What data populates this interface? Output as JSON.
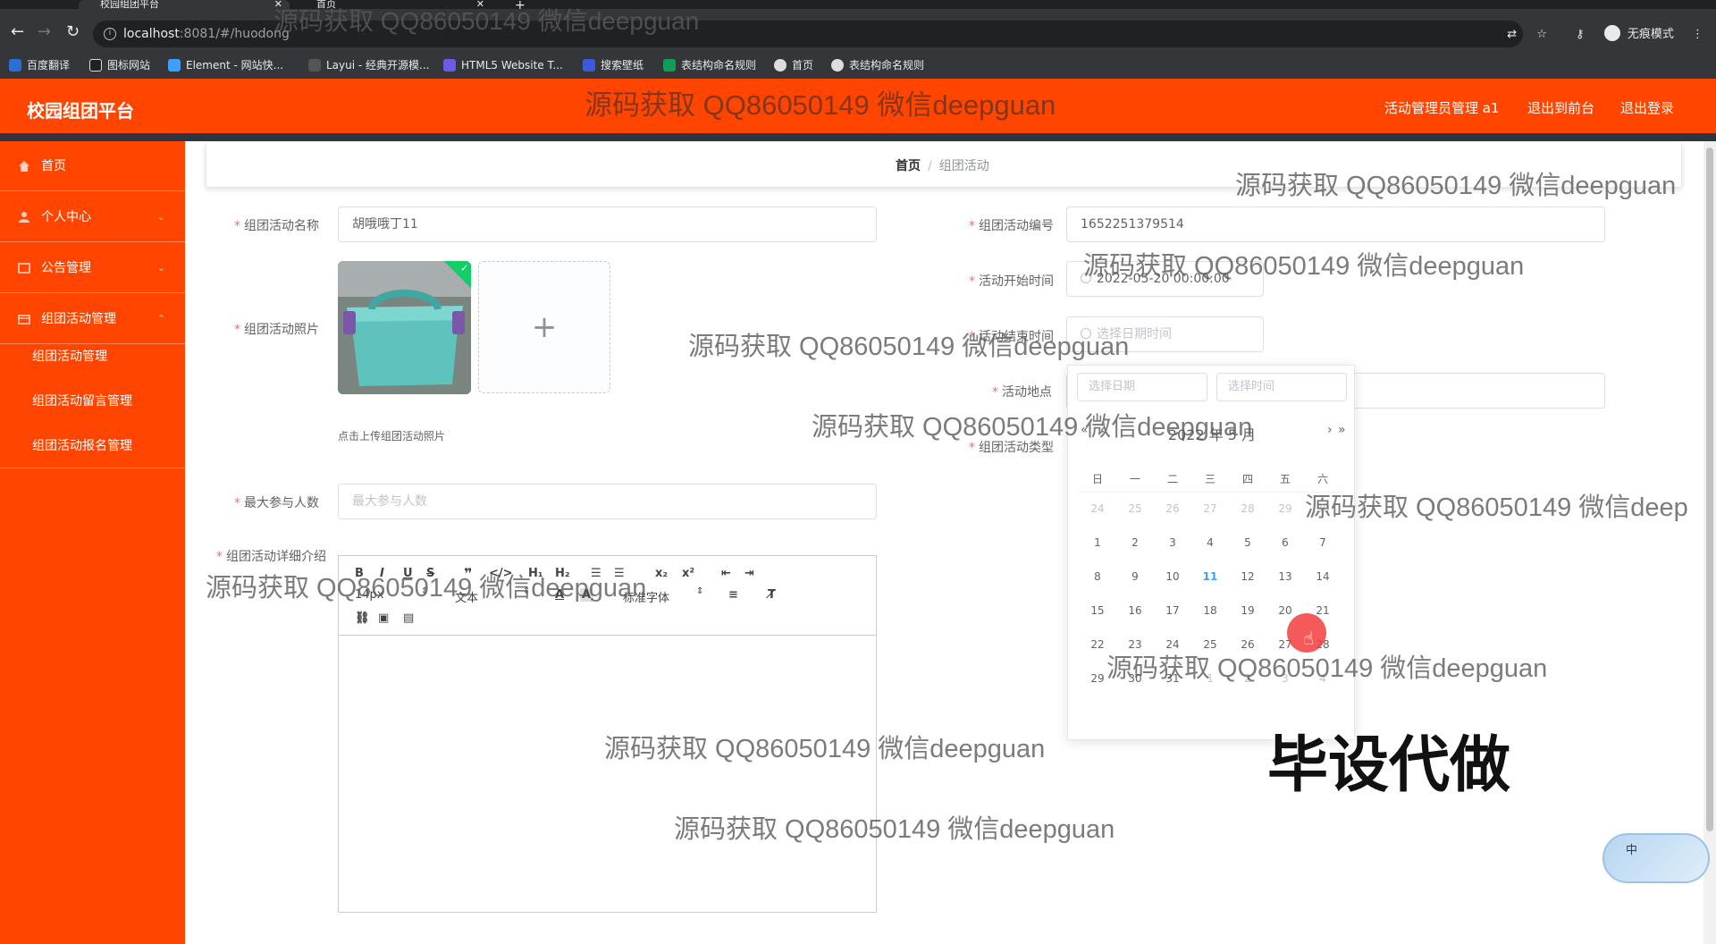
{
  "browser": {
    "tabs": [
      {
        "title": "校园组团平台"
      },
      {
        "title": "首页"
      }
    ],
    "url_host": "localhost",
    "url_path": ":8081/#/huodong",
    "profile_label": "无痕模式",
    "bookmarks": [
      {
        "label": "百度翻译",
        "color": "#2b6fd6"
      },
      {
        "label": "图标网站",
        "color": "#222222"
      },
      {
        "label": "Element - 网站快...",
        "color": "#409eff"
      },
      {
        "label": "Layui - 经典开源模...",
        "color": "#555555"
      },
      {
        "label": "HTML5 Website T...",
        "color": "#6b5ce7"
      },
      {
        "label": "搜索壁纸",
        "color": "#3b5bdb"
      },
      {
        "label": "表结构命名规则",
        "color": "#0f9d58"
      },
      {
        "label": "首页",
        "color": "#dddddd"
      },
      {
        "label": "表结构命名规则",
        "color": "#dddddd"
      }
    ]
  },
  "header": {
    "brand": "校园组团平台",
    "user": "活动管理员管理 a1",
    "to_front": "退出到前台",
    "logout": "退出登录",
    "accent": "#ff4500"
  },
  "sidebar": {
    "items": [
      {
        "label": "首页",
        "icon": "home-icon"
      },
      {
        "label": "个人中心",
        "icon": "user-icon"
      },
      {
        "label": "公告管理",
        "icon": "notice-icon"
      },
      {
        "label": "组团活动管理",
        "icon": "activity-icon"
      }
    ],
    "subitems": [
      {
        "label": "组团活动管理"
      },
      {
        "label": "组团活动留言管理"
      },
      {
        "label": "组团活动报名管理"
      }
    ]
  },
  "breadcrumb": {
    "home": "首页",
    "current": "组团活动"
  },
  "form": {
    "name_label": "组团活动名称",
    "name_value": "胡哦哦丁11",
    "code_label": "组团活动编号",
    "code_value": "1652251379514",
    "photo_label": "组团活动照片",
    "upload_hint": "点击上传组团活动照片",
    "start_label": "活动开始时间",
    "start_value": "2022-05-20 00:00:00",
    "end_label": "活动结束时间",
    "end_placeholder": "选择日期时间",
    "place_label": "活动地点",
    "type_label": "组团活动类型",
    "max_label": "最大参与人数",
    "max_placeholder": "最大参与人数",
    "detail_label": "组团活动详细介绍"
  },
  "editor": {
    "font_size": "14px",
    "paragraph": "文本",
    "font_family": "标准字体"
  },
  "datepicker": {
    "date_placeholder": "选择日期",
    "time_placeholder": "选择时间",
    "header": "2022 年 5 月",
    "weekdays": [
      "日",
      "一",
      "二",
      "三",
      "四",
      "五",
      "六"
    ],
    "weeks": [
      [
        "24",
        "25",
        "26",
        "27",
        "28",
        "29",
        "30"
      ],
      [
        "1",
        "2",
        "3",
        "4",
        "5",
        "6",
        "7"
      ],
      [
        "8",
        "9",
        "10",
        "11",
        "12",
        "13",
        "14"
      ],
      [
        "15",
        "16",
        "17",
        "18",
        "19",
        "20",
        "21"
      ],
      [
        "22",
        "23",
        "24",
        "25",
        "26",
        "27",
        "28"
      ],
      [
        "29",
        "30",
        "31",
        "1",
        "2",
        "3",
        "4"
      ]
    ]
  },
  "watermark": {
    "text": "源码获取 QQ86050149 微信deepguan",
    "partial": "源码获取 QQ86050149 微信deep",
    "big": "毕设代做"
  },
  "ime": {
    "label": "中"
  }
}
